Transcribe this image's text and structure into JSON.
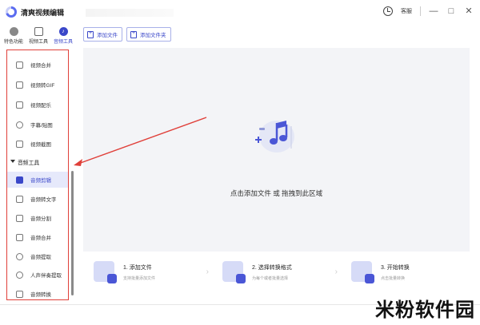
{
  "window": {
    "title": "清爽视频编辑",
    "user_label": "客服",
    "minimize": "—",
    "maximize": "□",
    "close": "✕"
  },
  "tool_tabs": [
    {
      "label": "特色功能",
      "icon": "feature-icon",
      "active": false
    },
    {
      "label": "视频工具",
      "icon": "video-tool-icon",
      "active": false
    },
    {
      "label": "音频工具",
      "icon": "audio-tool-icon",
      "active": true
    }
  ],
  "sidebar": {
    "video_items": [
      {
        "label": "视频合并",
        "icon": "merge-icon"
      },
      {
        "label": "视频转GIF",
        "icon": "gif-icon"
      },
      {
        "label": "视频配乐",
        "icon": "music-icon"
      },
      {
        "label": "字幕/贴图",
        "icon": "subtitle-icon"
      },
      {
        "label": "视频截图",
        "icon": "screenshot-icon"
      }
    ],
    "audio_group_label": "音频工具",
    "audio_items": [
      {
        "label": "音频剪辑",
        "icon": "audio-cut-icon",
        "active": true
      },
      {
        "label": "音频转文字",
        "icon": "audio-text-icon",
        "active": false
      },
      {
        "label": "音频分割",
        "icon": "audio-split-icon",
        "active": false
      },
      {
        "label": "音频合并",
        "icon": "audio-merge-icon",
        "active": false
      },
      {
        "label": "音频提取",
        "icon": "audio-extract-icon",
        "active": false
      },
      {
        "label": "人声伴奏提取",
        "icon": "vocal-extract-icon",
        "active": false
      },
      {
        "label": "音频转换",
        "icon": "audio-convert-icon",
        "active": false
      }
    ]
  },
  "toolbar": {
    "add_file": "添加文件",
    "add_folder": "添加文件夹"
  },
  "dropzone": {
    "text": "点击添加文件 或 拖拽到此区域",
    "icon": "audio-add-icon"
  },
  "steps": [
    {
      "title": "1. 添加文件",
      "subtitle": "支持批量添加文件"
    },
    {
      "title": "2. 选择转换格式",
      "subtitle": "为每个或者批量选择"
    },
    {
      "title": "3. 开始转换",
      "subtitle": "点击批量转换"
    }
  ],
  "watermark": "米粉软件园",
  "colors": {
    "accent": "#3a47c9",
    "annotation": "#e0403a"
  }
}
